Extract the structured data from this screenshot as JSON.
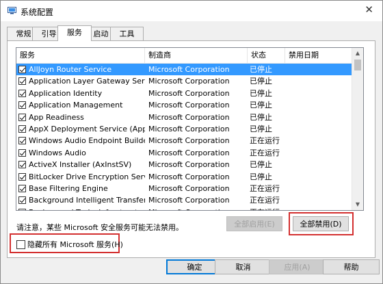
{
  "window": {
    "title": "系统配置",
    "close_glyph": "✕"
  },
  "tabs": [
    {
      "label": "常规",
      "active": false
    },
    {
      "label": "引导",
      "active": false
    },
    {
      "label": "服务",
      "active": true
    },
    {
      "label": "启动",
      "active": false
    },
    {
      "label": "工具",
      "active": false
    }
  ],
  "services": {
    "columns": [
      "服务",
      "制造商",
      "状态",
      "禁用日期"
    ],
    "rows": [
      {
        "name": "AllJoyn Router Service",
        "maker": "Microsoft Corporation",
        "status": "已停止",
        "date": "",
        "checked": true,
        "selected": true
      },
      {
        "name": "Application Layer Gateway Service",
        "maker": "Microsoft Corporation",
        "status": "已停止",
        "date": "",
        "checked": true
      },
      {
        "name": "Application Identity",
        "maker": "Microsoft Corporation",
        "status": "已停止",
        "date": "",
        "checked": true
      },
      {
        "name": "Application Management",
        "maker": "Microsoft Corporation",
        "status": "已停止",
        "date": "",
        "checked": true
      },
      {
        "name": "App Readiness",
        "maker": "Microsoft Corporation",
        "status": "已停止",
        "date": "",
        "checked": true
      },
      {
        "name": "AppX Deployment Service (AppX...",
        "maker": "Microsoft Corporation",
        "status": "已停止",
        "date": "",
        "checked": true
      },
      {
        "name": "Windows Audio Endpoint Builder",
        "maker": "Microsoft Corporation",
        "status": "正在运行",
        "date": "",
        "checked": true
      },
      {
        "name": "Windows Audio",
        "maker": "Microsoft Corporation",
        "status": "正在运行",
        "date": "",
        "checked": true
      },
      {
        "name": "ActiveX Installer (AxInstSV)",
        "maker": "Microsoft Corporation",
        "status": "已停止",
        "date": "",
        "checked": true
      },
      {
        "name": "BitLocker Drive Encryption Service",
        "maker": "Microsoft Corporation",
        "status": "已停止",
        "date": "",
        "checked": true
      },
      {
        "name": "Base Filtering Engine",
        "maker": "Microsoft Corporation",
        "status": "正在运行",
        "date": "",
        "checked": true
      },
      {
        "name": "Background Intelligent Transfer ...",
        "maker": "Microsoft Corporation",
        "status": "正在运行",
        "date": "",
        "checked": true
      },
      {
        "name": "Background Tasks Infrastructure ...",
        "maker": "Microsoft Corporation",
        "status": "正在运行",
        "date": "",
        "checked": true
      }
    ]
  },
  "notice": "请注意，某些 Microsoft 安全服务可能无法禁用。",
  "buttons": {
    "enable_all": "全部启用(E)",
    "disable_all": "全部禁用(D)",
    "ok": "确定",
    "cancel": "取消",
    "apply": "应用(A)",
    "help": "帮助"
  },
  "hide_ms": {
    "label": "隐藏所有 Microsoft 服务(H)",
    "checked": false
  },
  "colors": {
    "selection": "#3399ff",
    "highlight": "#d32f2f",
    "default_button_border": "#0078d7"
  }
}
